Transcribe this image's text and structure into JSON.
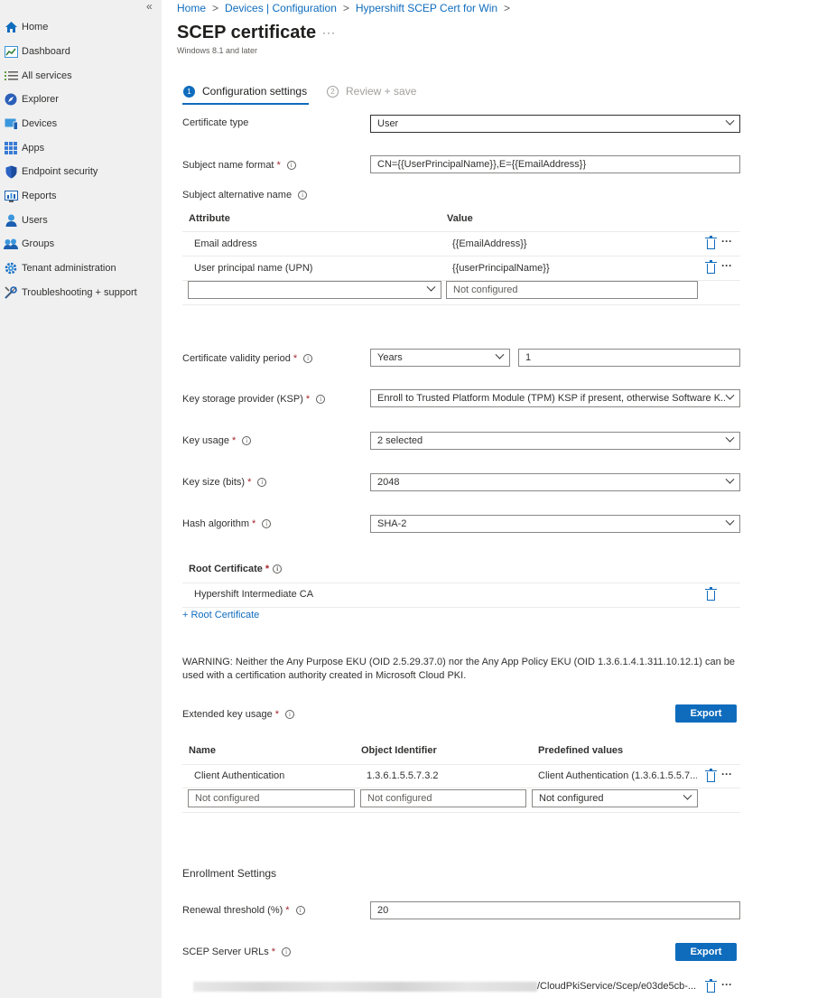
{
  "sidebar": {
    "collapse_glyph": "«",
    "items": [
      {
        "label": "Home",
        "icon": "home-icon"
      },
      {
        "label": "Dashboard",
        "icon": "dashboard-icon"
      },
      {
        "label": "All services",
        "icon": "list-icon"
      },
      {
        "label": "Explorer",
        "icon": "explorer-icon"
      },
      {
        "label": "Devices",
        "icon": "devices-icon"
      },
      {
        "label": "Apps",
        "icon": "apps-grid-icon"
      },
      {
        "label": "Endpoint security",
        "icon": "shield-icon"
      },
      {
        "label": "Reports",
        "icon": "reports-icon"
      },
      {
        "label": "Users",
        "icon": "user-icon"
      },
      {
        "label": "Groups",
        "icon": "groups-icon"
      },
      {
        "label": "Tenant administration",
        "icon": "gear-icon"
      },
      {
        "label": "Troubleshooting + support",
        "icon": "wrench-icon"
      }
    ]
  },
  "breadcrumb": [
    "Home",
    "Devices | Configuration",
    "Hypershift SCEP Cert for Win"
  ],
  "breadcrumb_sep": ">",
  "page": {
    "title": "SCEP certificate",
    "subtitle": "Windows 8.1 and later",
    "more": "···"
  },
  "steps": [
    {
      "num": "1",
      "label": "Configuration settings"
    },
    {
      "num": "2",
      "label": "Review + save"
    }
  ],
  "form": {
    "cert_type": {
      "label": "Certificate type",
      "value": "User"
    },
    "subject_name": {
      "label": "Subject name format",
      "value": "CN={{UserPrincipalName}},E={{EmailAddress}}"
    },
    "san": {
      "label": "Subject alternative name",
      "col_attribute": "Attribute",
      "col_value": "Value",
      "rows": [
        {
          "attribute": "Email address",
          "value": "{{EmailAddress}}"
        },
        {
          "attribute": "User principal name (UPN)",
          "value": "{{userPrincipalName}}"
        }
      ],
      "new_value_placeholder": "Not configured"
    },
    "validity": {
      "label": "Certificate validity period",
      "unit": "Years",
      "value": "1"
    },
    "ksp": {
      "label": "Key storage provider (KSP)",
      "value": "Enroll to Trusted Platform Module (TPM) KSP if present, otherwise Software K..."
    },
    "key_usage": {
      "label": "Key usage",
      "value": "2 selected"
    },
    "key_size": {
      "label": "Key size (bits)",
      "value": "2048"
    },
    "hash": {
      "label": "Hash algorithm",
      "value": "SHA-2"
    },
    "root_cert": {
      "label": "Root Certificate",
      "row": "Hypershift Intermediate CA",
      "add_link": "+ Root Certificate"
    },
    "warning": "WARNING: Neither the Any Purpose EKU (OID 2.5.29.37.0) nor the Any App Policy EKU (OID 1.3.6.1.4.1.311.10.12.1) can be used with a certification authority created in Microsoft Cloud PKI.",
    "eku": {
      "label": "Extended key usage",
      "export": "Export",
      "col_name": "Name",
      "col_oid": "Object Identifier",
      "col_predef": "Predefined values",
      "rows": [
        {
          "name": "Client Authentication",
          "oid": "1.3.6.1.5.5.7.3.2",
          "predef": "Client Authentication (1.3.6.1.5.5.7..."
        }
      ],
      "placeholder": "Not configured"
    },
    "enrollment": {
      "heading": "Enrollment Settings"
    },
    "renewal": {
      "label": "Renewal threshold (%)",
      "value": "20"
    },
    "scep_urls": {
      "label": "SCEP Server URLs",
      "export": "Export",
      "url_visible": "/CloudPkiService/Scep/e03de5cb-..."
    }
  },
  "colors": {
    "accent": "#0f6cbd",
    "required": "#a4262c",
    "sidebar_bg": "#f0f0f0"
  }
}
